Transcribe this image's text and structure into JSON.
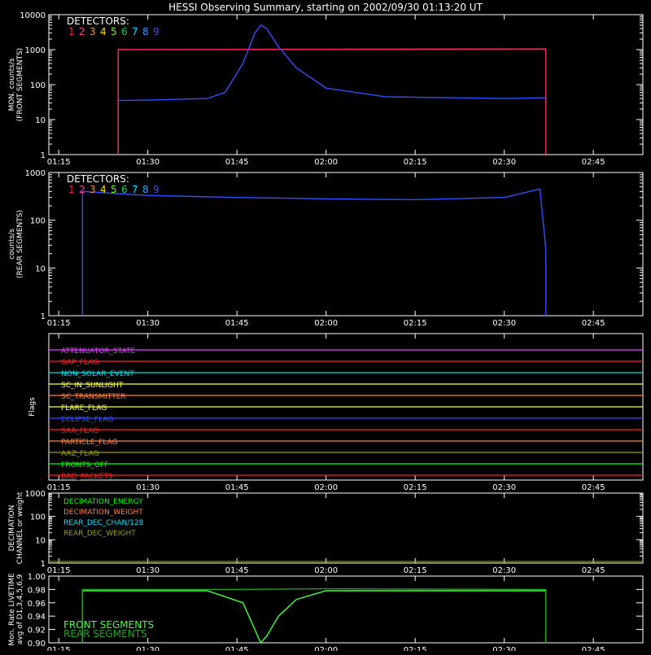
{
  "title": "HESSI Observing Summary, starting on 2002/09/30 01:13:20 UT",
  "time_ticks": [
    "01:15",
    "01:30",
    "01:45",
    "02:00",
    "02:15",
    "02:30",
    "02:45"
  ],
  "detector_colors": [
    "#ff2020",
    "#ff3fa0",
    "#ff9030",
    "#ffe000",
    "#70ff00",
    "#00d060",
    "#00e0ff",
    "#30a0ff",
    "#3050ff"
  ],
  "chart_data": [
    {
      "type": "line",
      "ylabel": "MON. counts/s",
      "ylabel2": "(FRONT SEGMENTS)",
      "yscale": "log",
      "ylim": [
        1,
        10000
      ],
      "ytick_labels": [
        "1",
        "10",
        "100",
        "1000",
        "10000"
      ],
      "xlim": [
        "01:13:20",
        "02:53:20"
      ],
      "legend_title": "DETECTORS:",
      "legend_items": [
        "1",
        "2",
        "3",
        "4",
        "5",
        "6",
        "7",
        "8",
        "9"
      ],
      "series": [
        {
          "color": "#ff2a60",
          "x": [
            "01:25",
            "01:25",
            "01:25",
            "02:37",
            "02:37",
            "02:37"
          ],
          "y": [
            1,
            40,
            1000,
            1050,
            40,
            1
          ]
        },
        {
          "color": "#3050ff",
          "x": [
            "01:25",
            "01:30",
            "01:40",
            "01:43",
            "01:46",
            "01:48",
            "01:49",
            "01:50",
            "01:52",
            "01:55",
            "02:00",
            "02:10",
            "02:30",
            "02:37"
          ],
          "y": [
            35,
            36,
            40,
            60,
            400,
            3000,
            5000,
            4000,
            1200,
            300,
            80,
            45,
            40,
            42
          ]
        }
      ]
    },
    {
      "type": "line",
      "ylabel": "counts/s",
      "ylabel2": "(REAR SEGMENTS)",
      "yscale": "log",
      "ylim": [
        1,
        1000
      ],
      "ytick_labels": [
        "1",
        "10",
        "100",
        "1000"
      ],
      "xlim": [
        "01:13:20",
        "02:53:20"
      ],
      "legend_title": "DETECTORS:",
      "legend_items": [
        "1",
        "2",
        "3",
        "4",
        "5",
        "6",
        "7",
        "8",
        "9"
      ],
      "series": [
        {
          "color": "#3050ff",
          "x": [
            "01:19",
            "01:19",
            "01:30",
            "01:45",
            "02:00",
            "02:15",
            "02:30",
            "02:36",
            "02:37",
            "02:37"
          ],
          "y": [
            1,
            400,
            330,
            300,
            280,
            270,
            300,
            450,
            25,
            1
          ]
        }
      ]
    },
    {
      "type": "line",
      "ylabel": "Flags",
      "xlim": [
        "01:13:20",
        "02:53:20"
      ],
      "flags": [
        {
          "name": "ATTENUATOR_STATE",
          "color": "#e040ff"
        },
        {
          "name": "GAP_FLAG",
          "color": "#ff2020"
        },
        {
          "name": "NON_SOLAR_EVENT",
          "color": "#00e0e0"
        },
        {
          "name": "SC_IN_SUNLIGHT",
          "color": "#ffff40"
        },
        {
          "name": "SC_TRANSMITTER",
          "color": "#ff8040"
        },
        {
          "name": "FLARE_FLAG",
          "color": "#ffff40"
        },
        {
          "name": "ECLIPSE_FLAG",
          "color": "#3050ff"
        },
        {
          "name": "SAA_FLAG",
          "color": "#ff2020"
        },
        {
          "name": "PARTICLE_FLAG",
          "color": "#ff8040"
        },
        {
          "name": "AAZ_FLAG",
          "color": "#a0a000"
        },
        {
          "name": "FRONTS_OFF",
          "color": "#00ff00"
        },
        {
          "name": "BAD_PACKETS",
          "color": "#ff2020"
        }
      ]
    },
    {
      "type": "line",
      "ylabel": "DECIMATION",
      "ylabel2": "CHANNEL or weight",
      "yscale": "log",
      "ylim": [
        1,
        1000
      ],
      "ytick_labels": [
        "1",
        "10",
        "100",
        "1000"
      ],
      "xlim": [
        "01:13:20",
        "02:53:20"
      ],
      "legend_items": [
        {
          "label": "DECIMATION_ENERGY",
          "color": "#00ff00"
        },
        {
          "label": "DECIMATION_WEIGHT",
          "color": "#ff8040"
        },
        {
          "label": "REAR_DEC_CHAN/128",
          "color": "#00e0ff"
        },
        {
          "label": "REAR_DEC_WEIGHT",
          "color": "#a0a000"
        }
      ]
    },
    {
      "type": "line",
      "ylabel": "Mon. Rate LIVETIME",
      "ylabel2": "avg of D1,3,4,5,6,9",
      "ylim": [
        0.9,
        1.0
      ],
      "ytick_labels": [
        "0.90",
        "0.92",
        "0.94",
        "0.96",
        "0.98",
        "1.00"
      ],
      "xlim": [
        "01:13:20",
        "02:53:20"
      ],
      "legend_items": [
        {
          "label": "FRONT SEGMENTS",
          "color": "#40ff40"
        },
        {
          "label": "REAR SEGMENTS",
          "color": "#20a020"
        }
      ],
      "series": [
        {
          "name": "FRONT SEGMENTS",
          "color": "#40ff40",
          "x": [
            "01:19",
            "01:19",
            "01:40",
            "01:46",
            "01:48",
            "01:49",
            "01:50",
            "01:52",
            "01:55",
            "02:00",
            "02:37",
            "02:37"
          ],
          "y": [
            0.9,
            0.978,
            0.978,
            0.96,
            0.92,
            0.9,
            0.91,
            0.94,
            0.965,
            0.978,
            0.978,
            0.9
          ]
        },
        {
          "name": "REAR SEGMENTS",
          "color": "#20a020",
          "x": [
            "01:19",
            "01:19",
            "01:45",
            "02:00",
            "02:37",
            "02:37"
          ],
          "y": [
            0.9,
            0.98,
            0.98,
            0.981,
            0.98,
            0.9
          ]
        }
      ]
    }
  ]
}
